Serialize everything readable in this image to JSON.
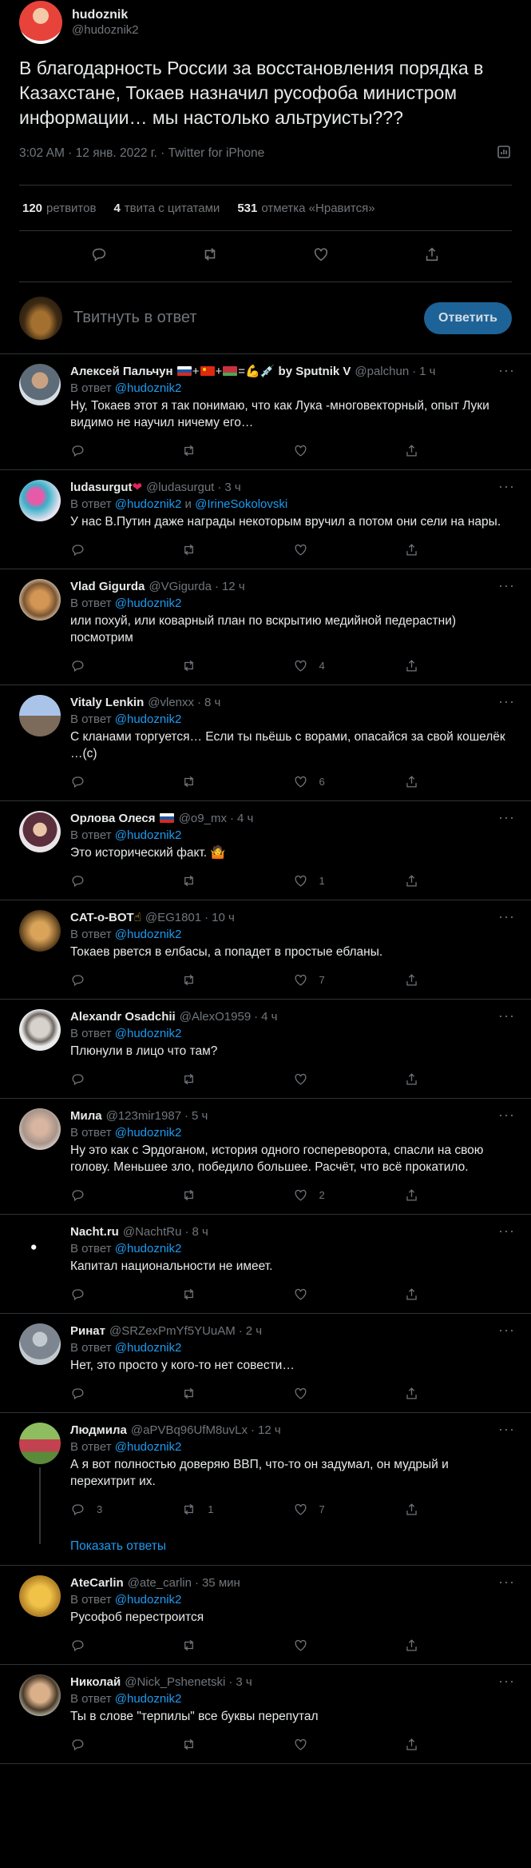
{
  "main_tweet": {
    "name": "hudoznik",
    "handle": "@hudoznik2",
    "text": "В благодарность России за восстановления порядка в Казахстане, Токаев назначил русофоба министром информации… мы настолько альтруисты???",
    "meta": "3:02 AM · 12 янв. 2022 г. · Twitter for iPhone",
    "retweets_count": "120",
    "retweets_label": "ретвитов",
    "quotes_count": "4",
    "quotes_label": "твита с цитатами",
    "likes_count": "531",
    "likes_label": "отметка «Нравится»"
  },
  "reply_box": {
    "placeholder": "Твитнуть в ответ",
    "button": "Ответить"
  },
  "reply_to_label": "В ответ",
  "and_label": "и",
  "show_replies": "Показать ответы",
  "replies": [
    {
      "name": "Алексей Пальчун",
      "name_suffix": "by Sputnik V",
      "handle": "@palchun",
      "time": "1 ч",
      "to": [
        "@hudoznik2"
      ],
      "text": "Ну, Токаев этот я так понимаю, что как Лука -многовекторный, опыт Луки видимо не научил ничему его…",
      "replies": "",
      "retweets": "",
      "likes": ""
    },
    {
      "name": "ludasurgut",
      "handle": "@ludasurgut",
      "time": "3 ч",
      "to": [
        "@hudoznik2",
        "@IrineSokolovski"
      ],
      "text": "У нас В.Путин даже награды некоторым вручил а потом они сели на нары.",
      "replies": "",
      "retweets": "",
      "likes": ""
    },
    {
      "name": "Vlad Gigurda",
      "handle": "@VGigurda",
      "time": "12 ч",
      "to": [
        "@hudoznik2"
      ],
      "text": "или похуй, или коварный план по вскрытию медийной педерастни) посмотрим",
      "replies": "",
      "retweets": "",
      "likes": "4"
    },
    {
      "name": "Vitaly Lenkin",
      "handle": "@vlenxx",
      "time": "8 ч",
      "to": [
        "@hudoznik2"
      ],
      "text": "С кланами торгуется… Если ты пьёшь с ворами, опасайся за свой кошелёк …(с)",
      "replies": "",
      "retweets": "",
      "likes": "6"
    },
    {
      "name": "Орлова Олеся",
      "handle": "@o9_mx",
      "time": "4 ч",
      "to": [
        "@hudoznik2"
      ],
      "text": "Это исторический факт. 🤷",
      "replies": "",
      "retweets": "",
      "likes": "1"
    },
    {
      "name": "CAT-o-BOT",
      "handle": "@EG1801",
      "time": "10 ч",
      "to": [
        "@hudoznik2"
      ],
      "text": "Токаев рвется в елбасы, а попадет в простые ебланы.",
      "replies": "",
      "retweets": "",
      "likes": "7"
    },
    {
      "name": "Alexandr Osadchii",
      "handle": "@AlexO1959",
      "time": "4 ч",
      "to": [
        "@hudoznik2"
      ],
      "text": "Плюнули в лицо что там?",
      "replies": "",
      "retweets": "",
      "likes": ""
    },
    {
      "name": "Мила",
      "handle": "@123mir1987",
      "time": "5 ч",
      "to": [
        "@hudoznik2"
      ],
      "text": "Ну это как с Эрдоганом, история одного госпереворота, спасли на свою голову.   Меньшее зло, победило большее. Расчёт, что всё прокатило.",
      "replies": "",
      "retweets": "",
      "likes": "2"
    },
    {
      "name": "Nacht.ru",
      "handle": "@NachtRu",
      "time": "8 ч",
      "to": [
        "@hudoznik2"
      ],
      "text": "Капитал национальности не имеет.",
      "replies": "",
      "retweets": "",
      "likes": ""
    },
    {
      "name": "Ринат",
      "handle": "@SRZexPmYf5YUuAM",
      "time": "2 ч",
      "to": [
        "@hudoznik2"
      ],
      "text": "Нет, это просто у кого-то нет совести…",
      "replies": "",
      "retweets": "",
      "likes": ""
    },
    {
      "name": "Людмила",
      "handle": "@aPVBq96UfM8uvLx",
      "time": "12 ч",
      "to": [
        "@hudoznik2"
      ],
      "text": "А я вот полностью доверяю ВВП, что-то он задумал, он мудрый и перехитрит их.",
      "replies": "3",
      "retweets": "1",
      "likes": "7"
    },
    {
      "name": "AteCarlin",
      "handle": "@ate_carlin",
      "time": "35 мин",
      "to": [
        "@hudoznik2"
      ],
      "text": "Русофоб перестроится",
      "replies": "",
      "retweets": "",
      "likes": ""
    },
    {
      "name": "Николай",
      "handle": "@Nick_Pshenetski",
      "time": "3 ч",
      "to": [
        "@hudoznik2"
      ],
      "text": "Ты в слове \"терпилы\" все буквы перепутал",
      "replies": "",
      "retweets": "",
      "likes": ""
    }
  ],
  "colors": {
    "background": "#000000",
    "text": "#e7e9ea",
    "muted": "#71767b",
    "link": "#1d9bf0",
    "divider": "#2f3336",
    "reply_button": "#1d6397"
  }
}
